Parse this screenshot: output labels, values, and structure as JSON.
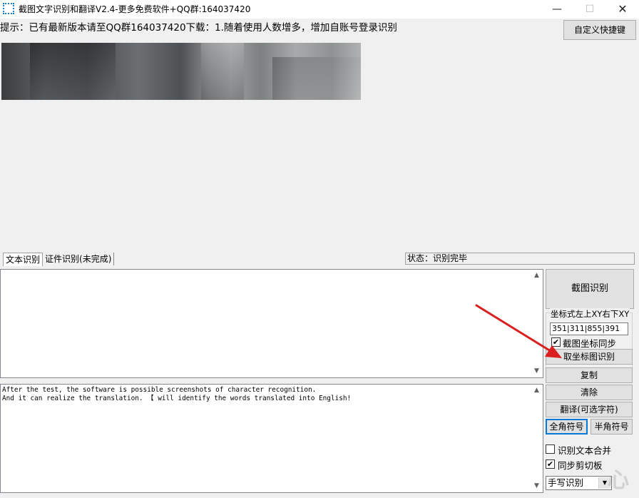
{
  "window": {
    "title": "截图文字识别和翻译V2.4-更多免费软件+QQ群:164037420",
    "min_glyph": "—",
    "max_glyph": "☐",
    "close_glyph": "✕"
  },
  "notice": "提示：已有最新版本请至QQ群164037420下载：1.随着使用人数增多，增加自账号登录识别",
  "shortcut_button": "自定义快捷键",
  "tabs": [
    {
      "label": "文本识别",
      "active": true
    },
    {
      "label": "证件识别(未完成)",
      "active": false
    }
  ],
  "status": "状态：识别完毕",
  "result_text": "",
  "translation_lines": [
    "After the test, the software is possible screenshots of character recognition.",
    "And it can realize the translation. 【 will identify the words translated into English!"
  ],
  "panel": {
    "capture_button": "截图识别",
    "coord_group_label": "坐标式左上XY右下XY",
    "coord_value": "351|311|855|391",
    "sync_checkbox": {
      "label": "截图坐标同步",
      "checked": true
    },
    "coord_button": "取坐标图识别",
    "copy_button": "复制",
    "clear_button": "清除",
    "translate_button": "翻译(可选字符)",
    "fullwidth_button": "全角符号",
    "halfwidth_button": "半角符号",
    "merge_checkbox": {
      "label": "识别文本合并",
      "checked": false
    },
    "clipboard_checkbox": {
      "label": "同步剪切板",
      "checked": true
    },
    "mode_select": "手写识别"
  },
  "icons": {
    "check_glyph": "✔",
    "scroll_up": "▲",
    "scroll_down": "▼",
    "dropdown_arrow": "▼"
  },
  "annotation_arrow_color": "#d9201f",
  "watermark": "心"
}
